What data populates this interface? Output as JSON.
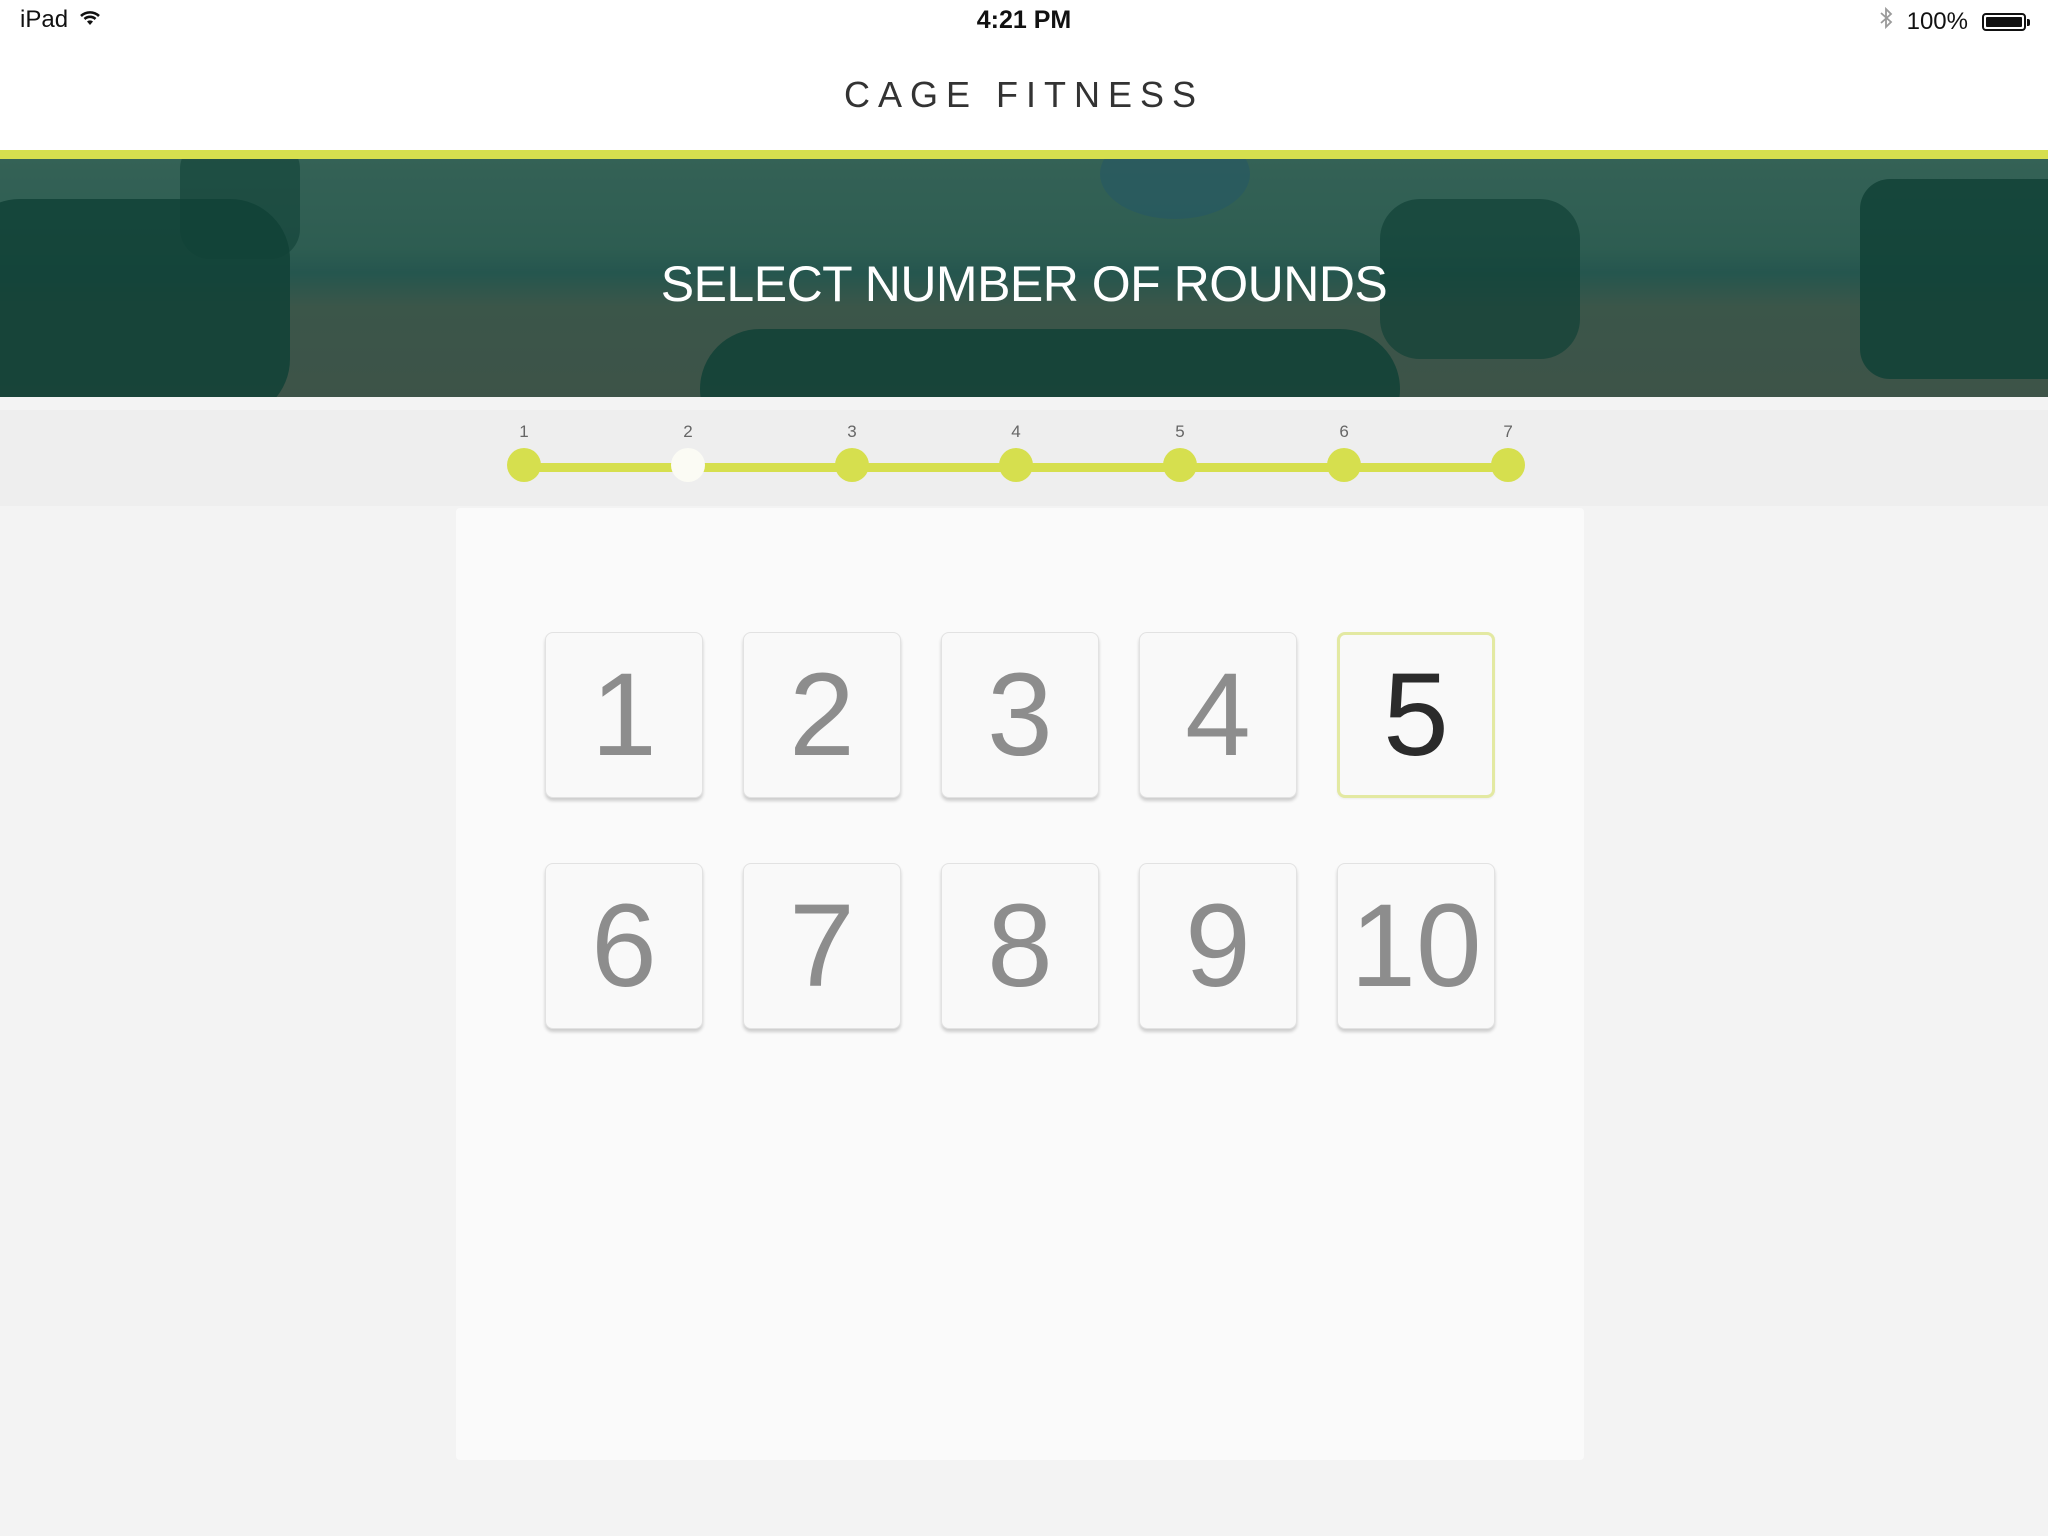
{
  "status_bar": {
    "device": "iPad",
    "time": "4:21 PM",
    "battery": "100%"
  },
  "header": {
    "title": "CAGE FITNESS"
  },
  "banner": {
    "title": "SELECT NUMBER OF ROUNDS"
  },
  "stepper": {
    "steps": [
      "1",
      "2",
      "3",
      "4",
      "5",
      "6",
      "7"
    ],
    "current_step": "2"
  },
  "rounds": {
    "options": [
      "1",
      "2",
      "3",
      "4",
      "5",
      "6",
      "7",
      "8",
      "9",
      "10"
    ],
    "selected": "5"
  },
  "colors": {
    "accent": "#d6df4e",
    "background": "#f3f3f3"
  },
  "icons": [
    "wifi-icon",
    "bluetooth-icon",
    "battery-icon"
  ]
}
